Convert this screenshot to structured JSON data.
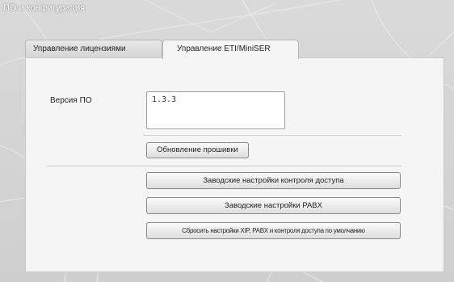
{
  "window": {
    "title": "ПО и конфигурация"
  },
  "tabs": [
    {
      "label": "Управление лицензиями",
      "active": false
    },
    {
      "label": "Управление ETI/MiniSER",
      "active": true
    }
  ],
  "software": {
    "version_label": "Версия ПО",
    "version_value": "1.3.3"
  },
  "buttons": {
    "firmware_update": "Обновление прошивки",
    "factory_access": "Заводские настройки контроля доступа",
    "factory_pabx": "Заводские настройки PABX",
    "reset_all": "Сбросить настройки XIP, PABX и контроля доступа по умолчанию"
  }
}
